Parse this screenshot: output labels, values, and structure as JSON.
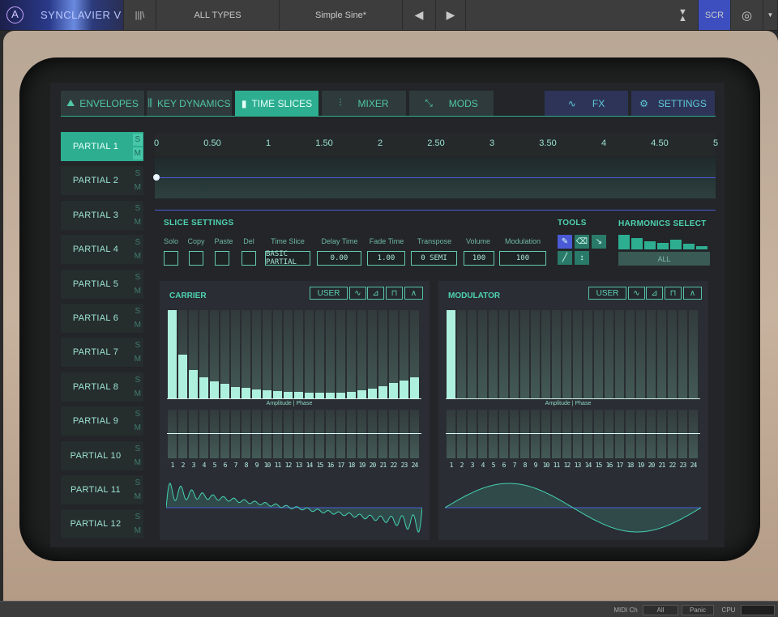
{
  "topbar": {
    "app_title": "SYNCLAVIER V",
    "logo_icon": "arturia-logo-icon",
    "library_icon": "library-icon",
    "types_label": "ALL TYPES",
    "preset_name": "Simple Sine*",
    "prev_icon": "previous-arrow-icon",
    "next_icon": "next-arrow-icon",
    "collapse_icon": "collapse-toolbar-icon",
    "scr_label": "SCR",
    "eye_icon": "eye-icon",
    "menu_icon": "dropdown-icon"
  },
  "tabs": [
    {
      "label": "ENVELOPES",
      "icon": "envelope-icon"
    },
    {
      "label": "KEY DYNAMICS",
      "icon": "key-dynamics-icon"
    },
    {
      "label": "TIME SLICES",
      "icon": "time-slices-icon",
      "active": true
    },
    {
      "label": "MIXER",
      "icon": "mixer-icon"
    },
    {
      "label": "MODS",
      "icon": "mods-icon"
    },
    {
      "label": "FX",
      "icon": "fx-wave-icon"
    },
    {
      "label": "SETTINGS",
      "icon": "gear-icon"
    }
  ],
  "partials": [
    {
      "label": "PARTIAL 1",
      "s": "S",
      "m": "M",
      "active": true
    },
    {
      "label": "PARTIAL 2",
      "s": "S",
      "m": "M"
    },
    {
      "label": "PARTIAL 3",
      "s": "S",
      "m": "M"
    },
    {
      "label": "PARTIAL 4",
      "s": "S",
      "m": "M"
    },
    {
      "label": "PARTIAL 5",
      "s": "S",
      "m": "M"
    },
    {
      "label": "PARTIAL 6",
      "s": "S",
      "m": "M"
    },
    {
      "label": "PARTIAL 7",
      "s": "S",
      "m": "M"
    },
    {
      "label": "PARTIAL 8",
      "s": "S",
      "m": "M"
    },
    {
      "label": "PARTIAL 9",
      "s": "S",
      "m": "M"
    },
    {
      "label": "PARTIAL 10",
      "s": "S",
      "m": "M"
    },
    {
      "label": "PARTIAL 11",
      "s": "S",
      "m": "M"
    },
    {
      "label": "PARTIAL 12",
      "s": "S",
      "m": "M"
    }
  ],
  "ruler": {
    "ticks": [
      "0",
      "0.50",
      "1",
      "1.50",
      "2",
      "2.50",
      "3",
      "3.50",
      "4",
      "4.50",
      "5"
    ]
  },
  "slice_settings": {
    "title": "SLICE SETTINGS",
    "labels": {
      "solo": "Solo",
      "copy": "Copy",
      "paste": "Paste",
      "del": "Del",
      "time_slice": "Time Slice",
      "delay_time": "Delay Time",
      "fade_time": "Fade Time",
      "transpose": "Transpose",
      "volume": "Volume",
      "modulation": "Modulation"
    },
    "values": {
      "time_slice": "BASIC PARTIAL",
      "delay_time": "0.00",
      "fade_time": "1.00",
      "transpose": "0 SEMI",
      "volume": "100",
      "modulation": "100"
    }
  },
  "tools": {
    "title": "TOOLS",
    "icons": [
      "pencil-icon",
      "eraser-icon",
      "cursor-icon",
      "line-icon",
      "vertical-move-icon"
    ]
  },
  "harmonics_select": {
    "title": "HARMONICS SELECT",
    "levels": [
      0.9,
      0.68,
      0.5,
      0.42,
      0.58,
      0.35,
      0.18
    ],
    "all_label": "ALL"
  },
  "carrier": {
    "title": "CARRIER",
    "user_label": "USER",
    "wave_icons": [
      "sine-wave-icon",
      "saw-wave-icon",
      "square-wave-icon",
      "triangle-wave-icon"
    ],
    "amp_phase_label": "Amplitude | Phase",
    "amplitudes": [
      1.0,
      0.5,
      0.33,
      0.25,
      0.2,
      0.17,
      0.14,
      0.125,
      0.11,
      0.1,
      0.09,
      0.085,
      0.08,
      0.075,
      0.07,
      0.07,
      0.075,
      0.08,
      0.1,
      0.12,
      0.15,
      0.18,
      0.21,
      0.25
    ]
  },
  "modulator": {
    "title": "MODULATOR",
    "user_label": "USER",
    "wave_icons": [
      "sine-wave-icon",
      "saw-wave-icon",
      "square-wave-icon",
      "triangle-wave-icon"
    ],
    "amp_phase_label": "Amplitude | Phase",
    "amplitudes": [
      1.0,
      0,
      0,
      0,
      0,
      0,
      0,
      0,
      0,
      0,
      0,
      0,
      0,
      0,
      0,
      0,
      0,
      0,
      0,
      0,
      0,
      0,
      0,
      0
    ]
  },
  "harmonic_numbers": [
    "1",
    "2",
    "3",
    "4",
    "5",
    "6",
    "7",
    "8",
    "9",
    "10",
    "11",
    "12",
    "13",
    "14",
    "15",
    "16",
    "17",
    "18",
    "19",
    "20",
    "21",
    "22",
    "23",
    "24"
  ],
  "statusbar": {
    "midi_ch_label": "MIDI Ch",
    "midi_ch_value": "All",
    "panic_label": "Panic",
    "cpu_label": "CPU"
  },
  "colors": {
    "accent": "#2dae91",
    "blue_tab": "#2d3458",
    "scr_button": "#3d4fbf",
    "bar_fill": "#aef0de"
  }
}
